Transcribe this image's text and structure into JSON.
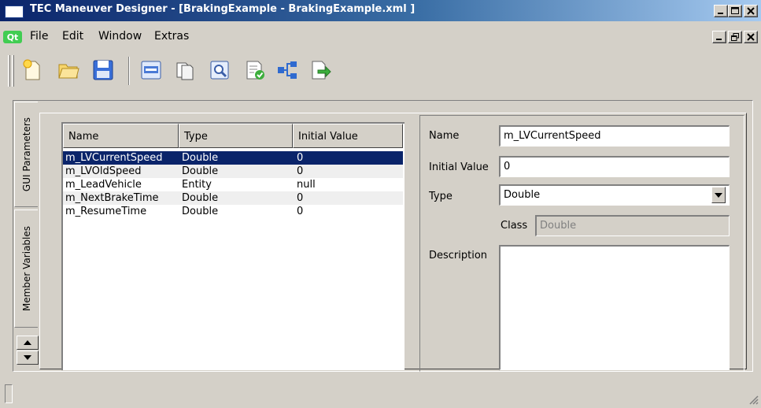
{
  "window": {
    "title": "TEC Maneuver Designer - [BrakingExample - BrakingExample.xml ]",
    "caption_buttons": [
      "minimize-icon",
      "maximize-icon",
      "close-icon"
    ]
  },
  "menubar": {
    "logo": "Qt",
    "items": [
      "File",
      "Edit",
      "Window",
      "Extras"
    ],
    "mdi_buttons": [
      "minimize-icon",
      "restore-icon",
      "close-icon"
    ]
  },
  "toolbar": {
    "buttons": [
      "new-document-icon",
      "open-folder-icon",
      "save-icon",
      "abc-icon",
      "copy-icon",
      "preview-icon",
      "validate-icon",
      "tree-icon",
      "export-icon"
    ]
  },
  "tabs": [
    {
      "label": "GUI Parameters",
      "active": false
    },
    {
      "label": "Member Variables",
      "active": true
    }
  ],
  "table": {
    "columns": [
      "Name",
      "Type",
      "Initial Value"
    ],
    "rows": [
      {
        "name": "m_LVCurrentSpeed",
        "type": "Double",
        "initial": "0",
        "selected": true
      },
      {
        "name": "m_LVOldSpeed",
        "type": "Double",
        "initial": "0",
        "selected": false
      },
      {
        "name": "m_LeadVehicle",
        "type": "Entity",
        "initial": "null",
        "selected": false
      },
      {
        "name": "m_NextBrakeTime",
        "type": "Double",
        "initial": "0",
        "selected": false
      },
      {
        "name": "m_ResumeTime",
        "type": "Double",
        "initial": "0",
        "selected": false
      }
    ]
  },
  "form": {
    "name_label": "Name",
    "name_value": "m_LVCurrentSpeed",
    "initial_label": "Initial Value",
    "initial_value": "0",
    "type_label": "Type",
    "type_value": "Double",
    "class_label": "Class",
    "class_value": "Double",
    "description_label": "Description",
    "description_value": ""
  },
  "colors": {
    "selection": "#0a246a",
    "face": "#d4d0c8",
    "title_start": "#0a246a",
    "title_end": "#a6caf0"
  }
}
